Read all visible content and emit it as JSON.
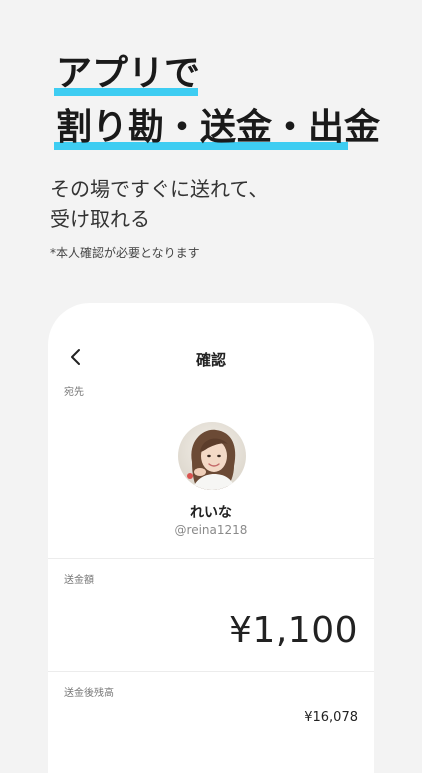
{
  "headline": {
    "line1": "アプリで",
    "line2": "割り勘・送金・出金"
  },
  "subcopy": {
    "line1": "その場ですぐに送れて、",
    "line2": "受け取れる"
  },
  "note": "*本人確認が必要となります",
  "screen": {
    "title": "確認",
    "recipient_label": "宛先",
    "recipient_name": "れいな",
    "recipient_id": "@reina1218",
    "amount_label": "送金額",
    "amount": "¥1,100",
    "balance_label": "送金後残高",
    "balance": "¥16,078"
  },
  "colors": {
    "highlight": "#3ecdf2",
    "background": "#f3f3f3"
  },
  "icons": {
    "back": "chevron-left-icon"
  }
}
